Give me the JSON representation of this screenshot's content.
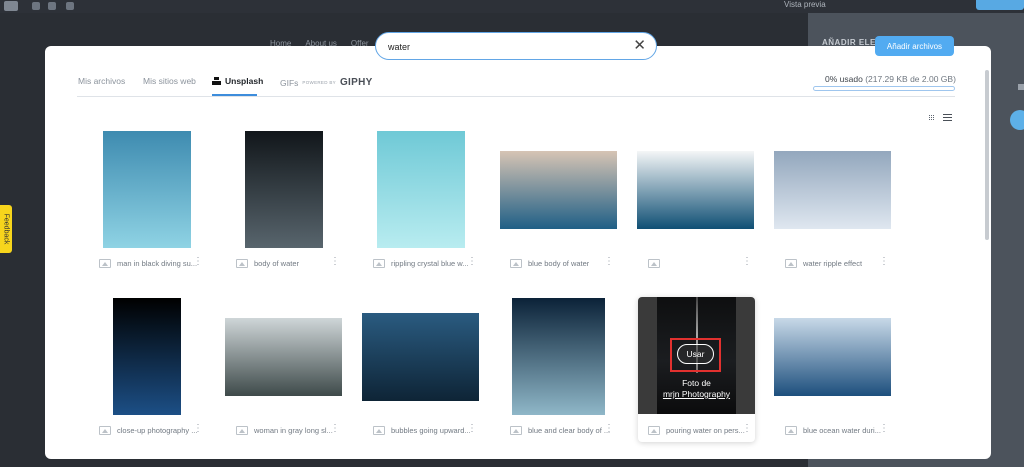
{
  "editor": {
    "preview_label": "Vista previa",
    "panel_title": "AÑADIR ELEMENTOS",
    "feedback_label": "Feedback",
    "nav_items": [
      "Home",
      "About us",
      "Offer"
    ]
  },
  "search": {
    "value": "water",
    "placeholder": ""
  },
  "modal": {
    "add_files_label": "Añadir archivos",
    "tabs": {
      "my_files": "Mis archivos",
      "my_sites": "Mis sitios web",
      "unsplash": "Unsplash",
      "gifs": "GIFs",
      "powered_by": "POWERED BY",
      "giphy": "GIPHY"
    },
    "usage": {
      "text": "0% usado",
      "detail": "(217.29 KB de 2.00 GB)",
      "percent": 0
    },
    "overlay": {
      "use_label": "Usar",
      "credit_prefix": "Foto de",
      "credit_author": "mrjn Photography"
    }
  },
  "colors": {
    "accent": "#3d8ddc",
    "highlight": "#e2312f",
    "feedback": "#f7d51c"
  },
  "images": [
    {
      "caption": "man in black diving su...",
      "colors": [
        "#3e8bb0",
        "#8fd3e4"
      ]
    },
    {
      "caption": "body of water",
      "colors": [
        "#11161a",
        "#58656d"
      ]
    },
    {
      "caption": "rippling crystal blue w...",
      "colors": [
        "#6fc9d6",
        "#b8ecf0"
      ]
    },
    {
      "caption": "blue body of water",
      "colors": [
        "#d6c4b4",
        "#1f5f86"
      ]
    },
    {
      "caption": "",
      "colors": [
        "#f4f6f7",
        "#0f4f74"
      ]
    },
    {
      "caption": "water ripple effect",
      "colors": [
        "#93a7bd",
        "#dfe7f0"
      ]
    },
    {
      "caption": "close-up photography ...",
      "colors": [
        "#000000",
        "#1c4f86"
      ]
    },
    {
      "caption": "woman in gray long sl...",
      "colors": [
        "#cfd6d8",
        "#3e4a4a"
      ]
    },
    {
      "caption": "bubbles going upward...",
      "colors": [
        "#2a5b80",
        "#0e2436"
      ]
    },
    {
      "caption": "blue and clear body of ...",
      "colors": [
        "#0b2238",
        "#8fb7c8"
      ]
    },
    {
      "caption": "pouring water on pers...",
      "colors": [
        "#1a1a1a",
        "#3a3a3a"
      ]
    },
    {
      "caption": "blue ocean water duri...",
      "colors": [
        "#c8d9e8",
        "#1d4f7d"
      ]
    }
  ]
}
